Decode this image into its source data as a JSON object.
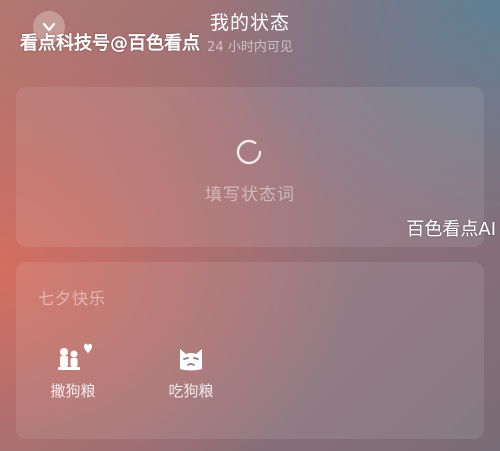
{
  "header": {
    "title": "我的状态",
    "subtitle": "24 小时内可见"
  },
  "input": {
    "placeholder": "填写状态词"
  },
  "qixi": {
    "heading": "七夕快乐",
    "items": [
      {
        "label": "撒狗粮",
        "icon": "couple-heart-icon"
      },
      {
        "label": "吃狗粮",
        "icon": "cat-face-icon"
      }
    ]
  },
  "watermarks": {
    "top": "看点科技号@百色看点",
    "right": "百色看点AI"
  }
}
